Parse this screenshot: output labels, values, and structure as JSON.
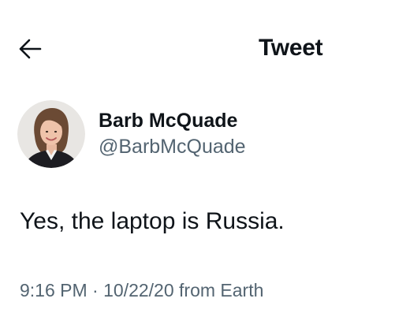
{
  "header": {
    "back_icon": "arrow-left-icon",
    "title": "Tweet"
  },
  "author": {
    "avatar_icon": "profile-photo",
    "display_name": "Barb McQuade",
    "handle": "@BarbMcQuade"
  },
  "tweet": {
    "text": "Yes, the laptop is Russia.",
    "time": "9:16 PM",
    "separator": " · ",
    "date": "10/22/20",
    "source": " from Earth"
  },
  "colors": {
    "primary_text": "#0f1419",
    "secondary_text": "#536471",
    "background": "#ffffff"
  }
}
